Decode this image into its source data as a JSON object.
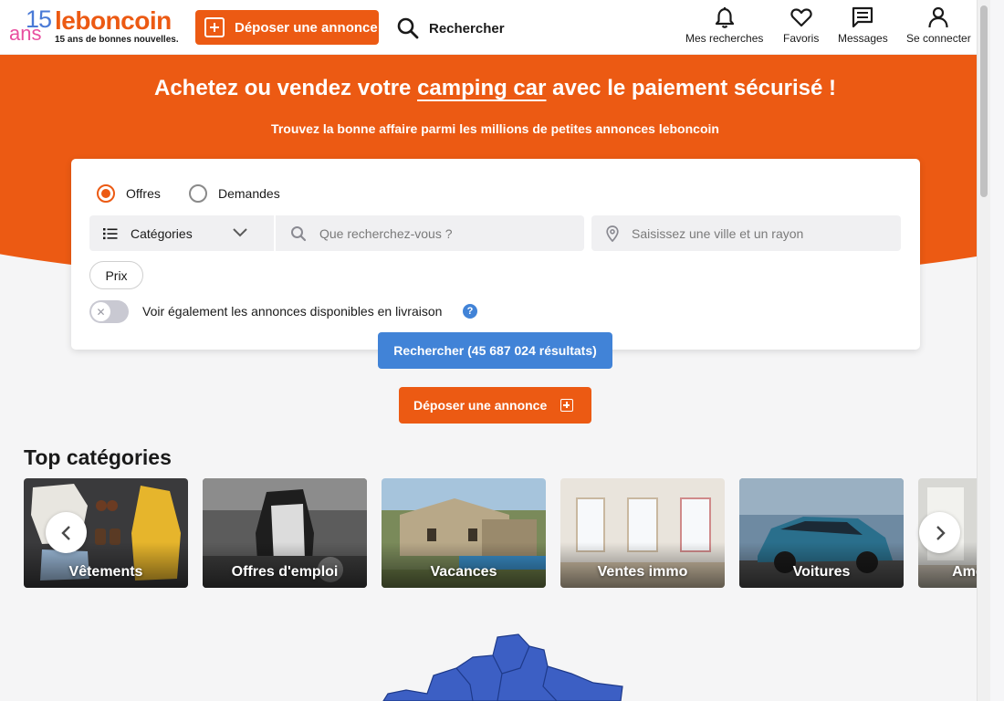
{
  "header": {
    "logo_number": "15",
    "logo_ans": "ans",
    "logo_brand": "leboncoin",
    "logo_tagline": "15 ans de bonnes nouvelles.",
    "deposit_label": "Déposer une annonce",
    "search_label": "Rechercher",
    "nav": [
      {
        "label": "Mes recherches",
        "icon": "bell-icon"
      },
      {
        "label": "Favoris",
        "icon": "heart-icon"
      },
      {
        "label": "Messages",
        "icon": "message-icon"
      },
      {
        "label": "Se connecter",
        "icon": "user-icon"
      }
    ]
  },
  "hero": {
    "title_before": "Achetez ou vendez votre ",
    "title_highlight": "camping car",
    "title_after": " avec le paiement sécurisé !",
    "subtitle": "Trouvez la bonne affaire parmi les millions de petites annonces leboncoin"
  },
  "search": {
    "radio_offers": "Offres",
    "radio_requests": "Demandes",
    "selected": "Offres",
    "categories_label": "Catégories",
    "query_placeholder": "Que recherchez-vous ?",
    "location_placeholder": "Saisissez une ville et un rayon",
    "price_filter": "Prix",
    "delivery_toggle_label": "Voir également les annonces disponibles en livraison",
    "delivery_toggle_on": false,
    "help_symbol": "?",
    "submit_label": "Rechercher (45 687 024 résultats)"
  },
  "deposit_mid_label": "Déposer une annonce",
  "top_categories": {
    "title": "Top catégories",
    "items": [
      {
        "label": "Vêtements"
      },
      {
        "label": "Offres d'emploi"
      },
      {
        "label": "Vacances"
      },
      {
        "label": "Ventes immo"
      },
      {
        "label": "Voitures"
      },
      {
        "label": "Ameublement"
      }
    ]
  },
  "colors": {
    "brand_orange": "#ec5a13",
    "action_blue": "#4183d7",
    "map_blue": "#3c5fc4"
  }
}
